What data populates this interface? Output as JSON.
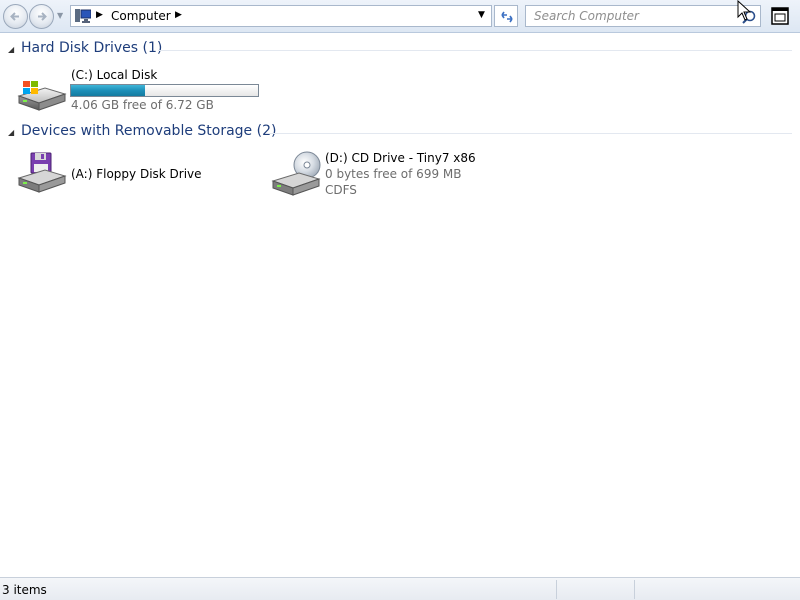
{
  "toolbar": {
    "address": {
      "crumb": "Computer"
    },
    "search": {
      "placeholder": "Search Computer"
    }
  },
  "groups": [
    {
      "title": "Hard Disk Drives (1)",
      "items": [
        {
          "name": "(C:) Local Disk",
          "free_text": "4.06 GB free of 6.72 GB",
          "used_fraction": 0.396,
          "icon": "hard-disk-windows-icon"
        }
      ]
    },
    {
      "title": "Devices with Removable Storage (2)",
      "items": [
        {
          "name": "(A:) Floppy Disk Drive",
          "icon": "floppy-drive-icon"
        },
        {
          "name": "(D:) CD Drive - Tiny7 x86",
          "free_text": "0 bytes free of 699 MB",
          "filesystem": "CDFS",
          "icon": "cd-drive-icon"
        }
      ]
    }
  ],
  "status": {
    "count_text": "3 items"
  },
  "colors": {
    "group_title": "#1e3d7b",
    "capacity_fill": "#1d8fb8",
    "toolbar_bg": "#dde7f3"
  }
}
